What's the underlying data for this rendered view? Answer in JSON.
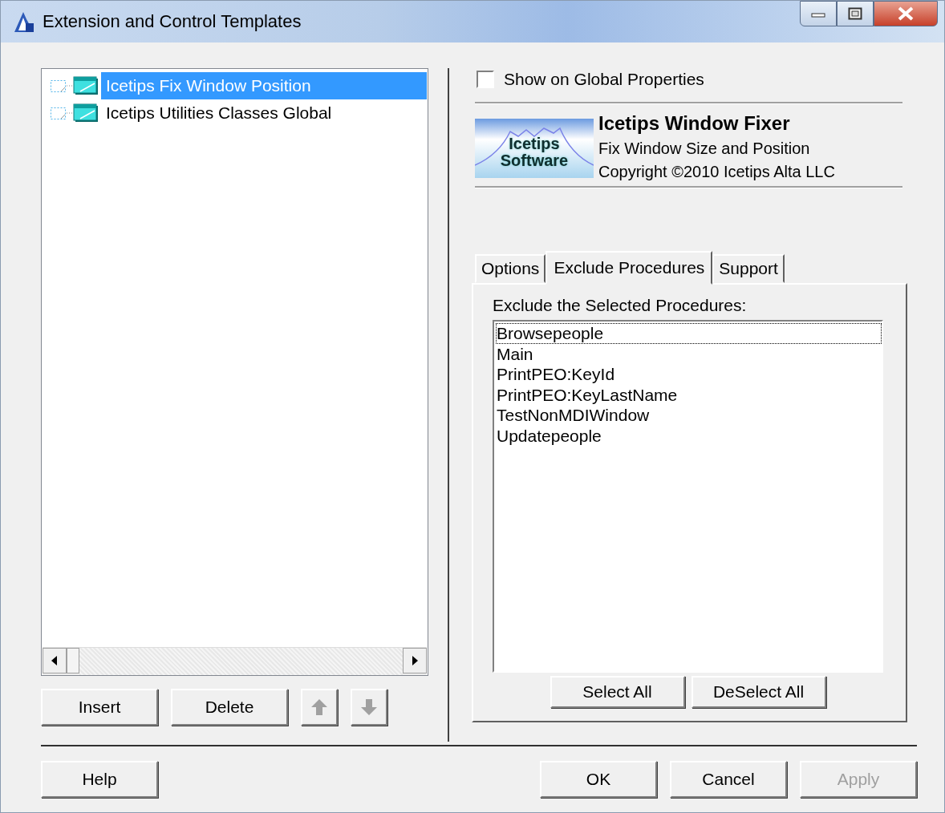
{
  "window": {
    "title": "Extension and Control Templates"
  },
  "templates": [
    {
      "label": "Icetips Fix Window Position",
      "selected": true
    },
    {
      "label": "Icetips Utilities Classes Global",
      "selected": false
    }
  ],
  "left_buttons": [
    {
      "kind": "text",
      "label": "Insert",
      "disabled": false
    },
    {
      "kind": "text",
      "label": "Delete",
      "disabled": false
    },
    {
      "kind": "up",
      "disabled": true
    },
    {
      "kind": "down",
      "disabled": true
    }
  ],
  "show_on_global": {
    "label": "Show on Global Properties",
    "checked": false
  },
  "about": {
    "logo": {
      "line_1": "Icetips",
      "line_2": "Software"
    },
    "title": "Icetips Window Fixer",
    "subtitle": "Fix Window Size and Position",
    "copyright": "Copyright ©2010 Icetips Alta LLC"
  },
  "tabs": [
    {
      "label": "Options",
      "selected": false
    },
    {
      "label": "Exclude Procedures",
      "selected": true
    },
    {
      "label": "Support",
      "selected": false
    }
  ],
  "procedures_label": "Exclude the Selected Procedures:",
  "procedures": [
    {
      "label": "Browsepeople",
      "selected": false,
      "focused": true
    },
    {
      "label": "Main",
      "selected": false,
      "focused": false
    },
    {
      "label": "PrintPEO:KeyId",
      "selected": false,
      "focused": false
    },
    {
      "label": "PrintPEO:KeyLastName",
      "selected": false,
      "focused": false
    },
    {
      "label": "TestNonMDIWindow",
      "selected": false,
      "focused": false
    },
    {
      "label": "Updatepeople",
      "selected": false,
      "focused": false
    }
  ],
  "procedure_buttons": [
    {
      "label": "Select All",
      "disabled": false
    },
    {
      "label": "DeSelect All",
      "disabled": false
    }
  ],
  "help_button": {
    "label": "Help",
    "disabled": false
  },
  "dialog_buttons": [
    {
      "label": "OK",
      "disabled": false
    },
    {
      "label": "Cancel",
      "disabled": false
    },
    {
      "label": "Apply",
      "disabled": true
    }
  ]
}
